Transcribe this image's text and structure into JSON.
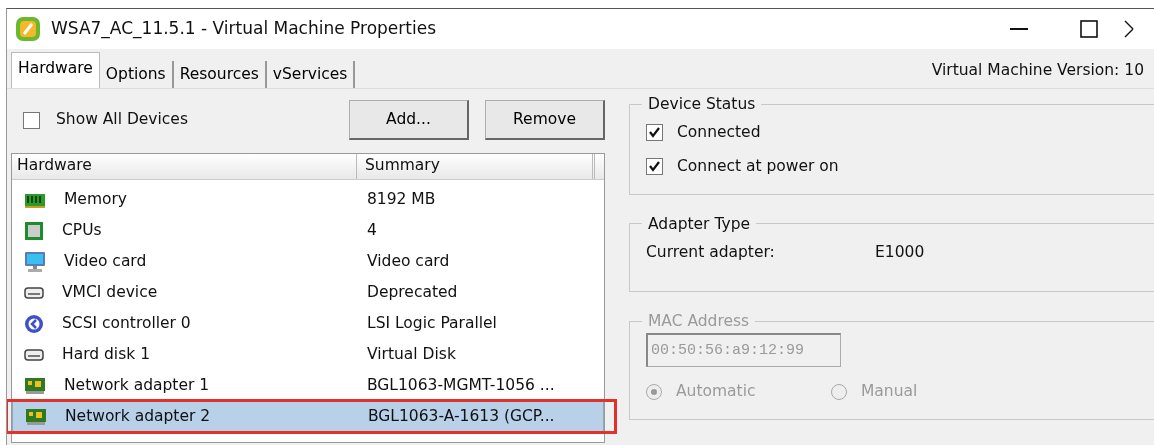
{
  "window": {
    "title": "WSA7_AC_11.5.1 - Virtual Machine Properties"
  },
  "tabs": [
    {
      "label": "Hardware",
      "selected": true
    },
    {
      "label": "Options",
      "selected": false
    },
    {
      "label": "Resources",
      "selected": false
    },
    {
      "label": "vServices",
      "selected": false
    }
  ],
  "vm_version": "Virtual Machine Version: 10",
  "show_all_devices": {
    "label": "Show All Devices",
    "checked": false
  },
  "buttons": [
    "Add...",
    "Remove"
  ],
  "table": {
    "columns": [
      "Hardware",
      "Summary"
    ],
    "rows": [
      {
        "kind": "memory",
        "name": "Memory",
        "summary": "8192 MB",
        "selected": false,
        "highlighted": false
      },
      {
        "kind": "cpu",
        "name": "CPUs",
        "summary": "4",
        "selected": false,
        "highlighted": false
      },
      {
        "kind": "video",
        "name": "Video card",
        "summary": "Video card",
        "selected": false,
        "highlighted": false
      },
      {
        "kind": "device",
        "name": "VMCI device",
        "summary": "Deprecated",
        "selected": false,
        "highlighted": false
      },
      {
        "kind": "scsi",
        "name": "SCSI controller 0",
        "summary": "LSI Logic Parallel",
        "selected": false,
        "highlighted": false
      },
      {
        "kind": "device",
        "name": "Hard disk 1",
        "summary": "Virtual Disk",
        "selected": false,
        "highlighted": false
      },
      {
        "kind": "network",
        "name": "Network adapter 1",
        "summary": "BGL1063-MGMT-1056 ...",
        "selected": false,
        "highlighted": false
      },
      {
        "kind": "network",
        "name": "Network adapter 2",
        "summary": "BGL1063-A-1613 (GCP...",
        "selected": true,
        "highlighted": true
      }
    ]
  },
  "device_status": {
    "title": "Device Status",
    "options": [
      {
        "label": "Connected",
        "checked": true
      },
      {
        "label": "Connect at power on",
        "checked": true
      }
    ]
  },
  "adapter_type": {
    "title": "Adapter Type",
    "label": "Current adapter:",
    "value": "E1000"
  },
  "mac_address": {
    "title": "MAC Address",
    "disabled": true,
    "value": "00:50:56:a9:12:99",
    "options": [
      {
        "label": "Automatic",
        "selected": true
      },
      {
        "label": "Manual",
        "selected": false
      }
    ]
  }
}
